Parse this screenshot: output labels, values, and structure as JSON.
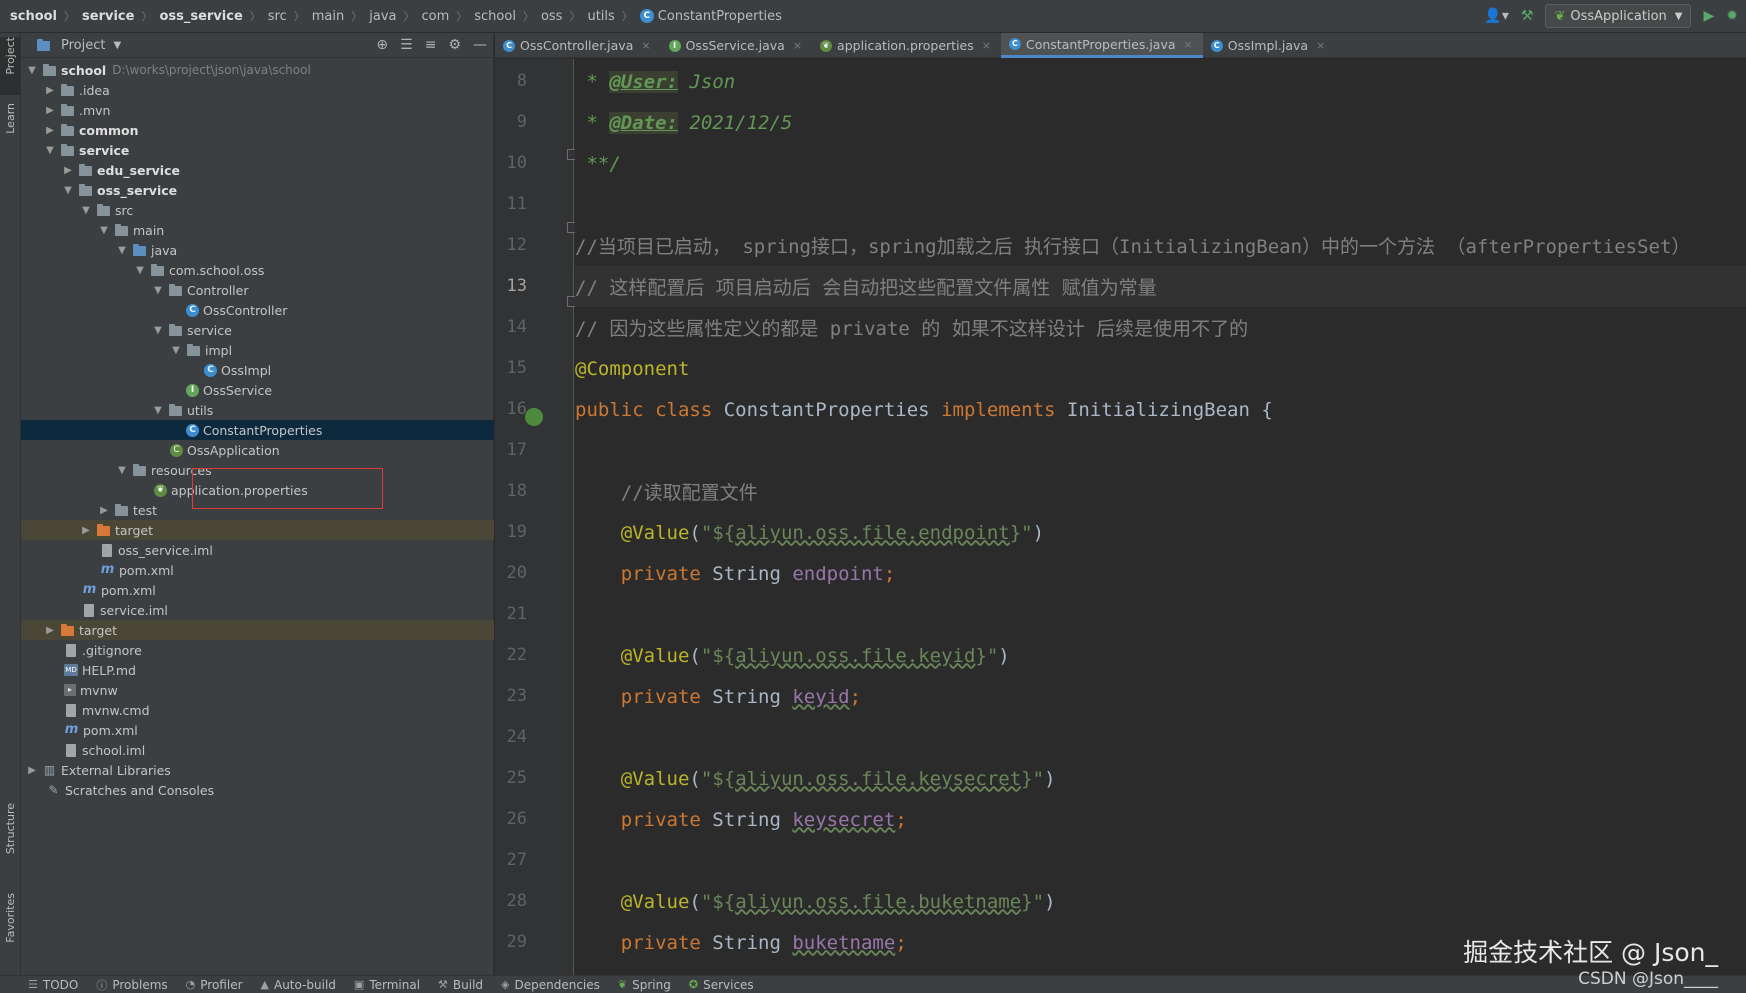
{
  "breadcrumb": [
    "school",
    "service",
    "oss_service",
    "src",
    "main",
    "java",
    "com",
    "school",
    "oss",
    "utils",
    "ConstantProperties"
  ],
  "toolbar": {
    "run_config": "OssApplication"
  },
  "left_stripe": {
    "project": "Project",
    "learn": "Learn",
    "structure": "Structure",
    "favorites": "Favorites"
  },
  "project_panel": {
    "title": "Project",
    "tree": [
      {
        "label": "school",
        "path": "D:\\works\\project\\json\\java\\school"
      },
      {
        "label": ".idea"
      },
      {
        "label": ".mvn"
      },
      {
        "label": "common"
      },
      {
        "label": "service"
      },
      {
        "label": "edu_service"
      },
      {
        "label": "oss_service"
      },
      {
        "label": "src"
      },
      {
        "label": "main"
      },
      {
        "label": "java"
      },
      {
        "label": "com.school.oss"
      },
      {
        "label": "Controller"
      },
      {
        "label": "OssController"
      },
      {
        "label": "service"
      },
      {
        "label": "impl"
      },
      {
        "label": "OssImpl"
      },
      {
        "label": "OssService"
      },
      {
        "label": "utils"
      },
      {
        "label": "ConstantProperties"
      },
      {
        "label": "OssApplication"
      },
      {
        "label": "resources"
      },
      {
        "label": "application.properties"
      },
      {
        "label": "test"
      },
      {
        "label": "target"
      },
      {
        "label": "oss_service.iml"
      },
      {
        "label": "pom.xml"
      },
      {
        "label": "pom.xml"
      },
      {
        "label": "service.iml"
      },
      {
        "label": "target"
      },
      {
        "label": ".gitignore"
      },
      {
        "label": "HELP.md"
      },
      {
        "label": "mvnw"
      },
      {
        "label": "mvnw.cmd"
      },
      {
        "label": "pom.xml"
      },
      {
        "label": "school.iml"
      },
      {
        "label": "External Libraries"
      },
      {
        "label": "Scratches and Consoles"
      }
    ]
  },
  "editor_tabs": [
    "OssController.java",
    "OssService.java",
    "application.properties",
    "ConstantProperties.java",
    "OssImpl.java"
  ],
  "code_lines": [
    {
      "n": "8",
      "parts": [
        [
          " * ",
          "doc"
        ],
        [
          "@User:",
          "doctag"
        ],
        [
          " Json",
          "doc"
        ]
      ]
    },
    {
      "n": "9",
      "parts": [
        [
          " * ",
          "doc"
        ],
        [
          "@Date:",
          "doctag"
        ],
        [
          " 2021/12/5",
          "doc"
        ]
      ]
    },
    {
      "n": "10",
      "parts": [
        [
          " **/",
          "doc"
        ]
      ]
    },
    {
      "n": "11",
      "parts": []
    },
    {
      "n": "12",
      "parts": [
        [
          "//当项目已启动， spring接口，spring加载之后 执行接口（InitializingBean）中的一个方法 （afterPropertiesSet）",
          "cmt"
        ]
      ]
    },
    {
      "n": "13",
      "parts": [
        [
          "// 这样配置后 项目启动后 会自动把这些配置文件属性 赋值为常量",
          "cmt"
        ]
      ]
    },
    {
      "n": "14",
      "parts": [
        [
          "// 因为这些属性定义的都是 private 的 如果不这样设计 后续是使用不了的",
          "cmt"
        ]
      ]
    },
    {
      "n": "15",
      "parts": [
        [
          "@Component",
          "ann"
        ]
      ]
    },
    {
      "n": "16",
      "parts": [
        [
          "public class ",
          "k"
        ],
        [
          "ConstantProperties ",
          ""
        ],
        [
          "implements ",
          "k"
        ],
        [
          "InitializingBean {",
          ""
        ]
      ]
    },
    {
      "n": "17",
      "parts": []
    },
    {
      "n": "18",
      "parts": [
        [
          "    //读取配置文件",
          "cmt"
        ]
      ]
    },
    {
      "n": "19",
      "parts": [
        [
          "    ",
          ""
        ],
        [
          "@Value",
          "ann"
        ],
        [
          "(",
          ""
        ],
        [
          "\"${",
          "str"
        ],
        [
          "aliyun.oss.file.endpoint",
          "str wavy"
        ],
        [
          "}\"",
          "str"
        ],
        [
          ")",
          ""
        ]
      ]
    },
    {
      "n": "20",
      "parts": [
        [
          "    ",
          ""
        ],
        [
          "private ",
          "k"
        ],
        [
          "String ",
          ""
        ],
        [
          "endpoint",
          "fld"
        ],
        [
          ";",
          "k"
        ]
      ]
    },
    {
      "n": "21",
      "parts": []
    },
    {
      "n": "22",
      "parts": [
        [
          "    ",
          ""
        ],
        [
          "@Value",
          "ann"
        ],
        [
          "(",
          ""
        ],
        [
          "\"${",
          "str"
        ],
        [
          "aliyun.oss.file.keyid",
          "str wavy"
        ],
        [
          "}\"",
          "str"
        ],
        [
          ")",
          ""
        ]
      ]
    },
    {
      "n": "23",
      "parts": [
        [
          "    ",
          ""
        ],
        [
          "private ",
          "k"
        ],
        [
          "String ",
          ""
        ],
        [
          "keyid",
          "fld wavy"
        ],
        [
          ";",
          "k"
        ]
      ]
    },
    {
      "n": "24",
      "parts": []
    },
    {
      "n": "25",
      "parts": [
        [
          "    ",
          ""
        ],
        [
          "@Value",
          "ann"
        ],
        [
          "(",
          ""
        ],
        [
          "\"${",
          "str"
        ],
        [
          "aliyun.oss.file.keysecret",
          "str wavy"
        ],
        [
          "}\"",
          "str"
        ],
        [
          ")",
          ""
        ]
      ]
    },
    {
      "n": "26",
      "parts": [
        [
          "    ",
          ""
        ],
        [
          "private ",
          "k"
        ],
        [
          "String ",
          ""
        ],
        [
          "keysecret",
          "fld wavy"
        ],
        [
          ";",
          "k"
        ]
      ]
    },
    {
      "n": "27",
      "parts": []
    },
    {
      "n": "28",
      "parts": [
        [
          "    ",
          ""
        ],
        [
          "@Value",
          "ann"
        ],
        [
          "(",
          ""
        ],
        [
          "\"${",
          "str"
        ],
        [
          "aliyun.oss.file.buketname",
          "str wavy"
        ],
        [
          "}\"",
          "str"
        ],
        [
          ")",
          ""
        ]
      ]
    },
    {
      "n": "29",
      "parts": [
        [
          "    ",
          ""
        ],
        [
          "private ",
          "k"
        ],
        [
          "String ",
          ""
        ],
        [
          "buketname",
          "fld wavy"
        ],
        [
          ";",
          "k"
        ]
      ]
    }
  ],
  "status_bar": [
    "TODO",
    "Problems",
    "Profiler",
    "Auto-build",
    "Terminal",
    "Build",
    "Dependencies",
    "Spring",
    "Services"
  ],
  "watermark": {
    "line1": "掘金技术社区 @ Json_",
    "line2": "CSDN @Json____"
  }
}
